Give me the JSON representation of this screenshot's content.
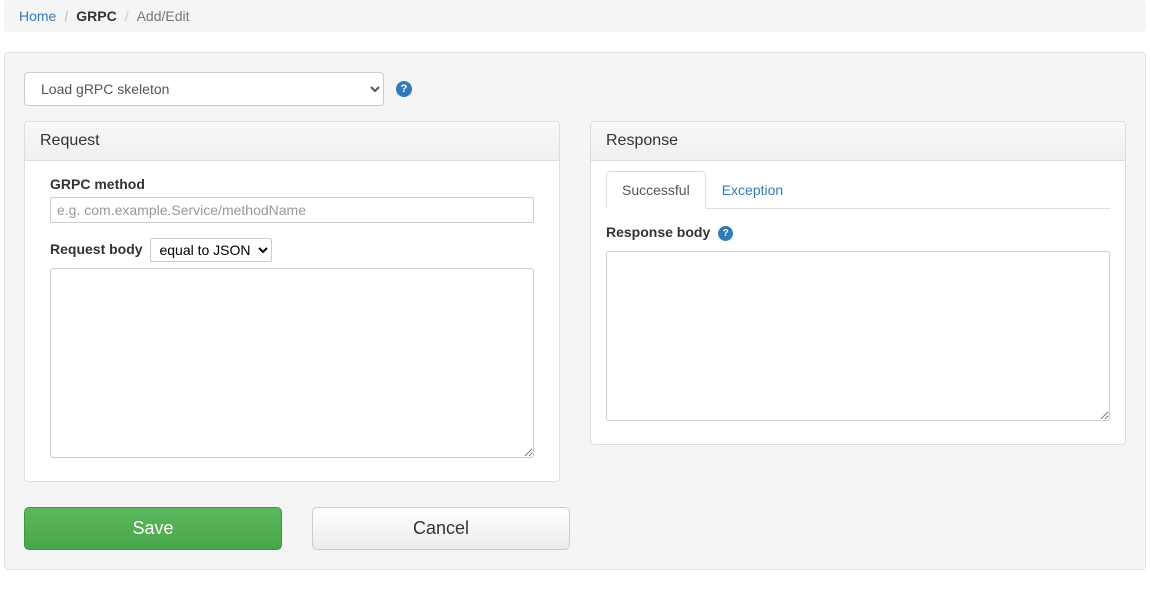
{
  "breadcrumb": {
    "home": "Home",
    "section": "GRPC",
    "current": "Add/Edit"
  },
  "skeleton": {
    "selected": "Load gRPC skeleton"
  },
  "request": {
    "panel_title": "Request",
    "method_label": "GRPC method",
    "method_placeholder": "e.g. com.example.Service/methodName",
    "method_value": "",
    "body_label": "Request body",
    "body_match_selected": "equal to JSON",
    "body_value": ""
  },
  "response": {
    "panel_title": "Response",
    "tabs": {
      "successful": "Successful",
      "exception": "Exception"
    },
    "body_label": "Response body",
    "body_value": ""
  },
  "buttons": {
    "save": "Save",
    "cancel": "Cancel"
  },
  "help_glyph": "?"
}
